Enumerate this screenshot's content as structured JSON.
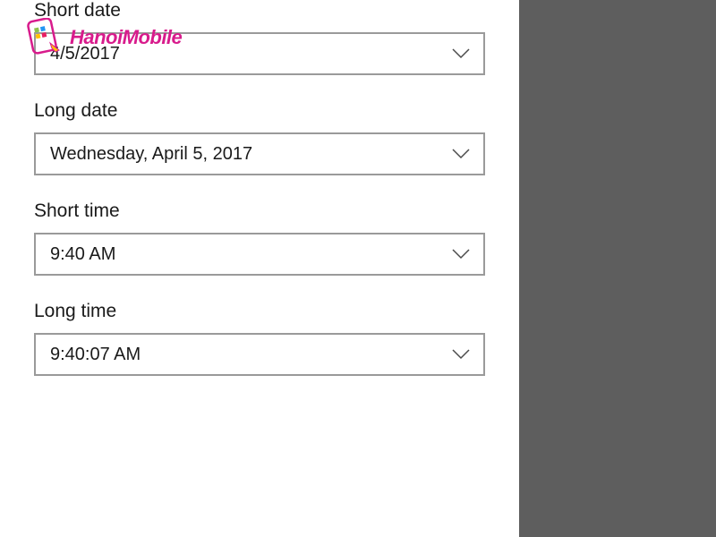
{
  "watermark": {
    "text": "HanoiMobile"
  },
  "fields": {
    "short_date": {
      "label": "Short date",
      "value": "4/5/2017"
    },
    "long_date": {
      "label": "Long date",
      "value": "Wednesday, April 5, 2017"
    },
    "short_time": {
      "label": "Short time",
      "value": "9:40 AM"
    },
    "long_time": {
      "label": "Long time",
      "value": "9:40:07 AM"
    }
  }
}
